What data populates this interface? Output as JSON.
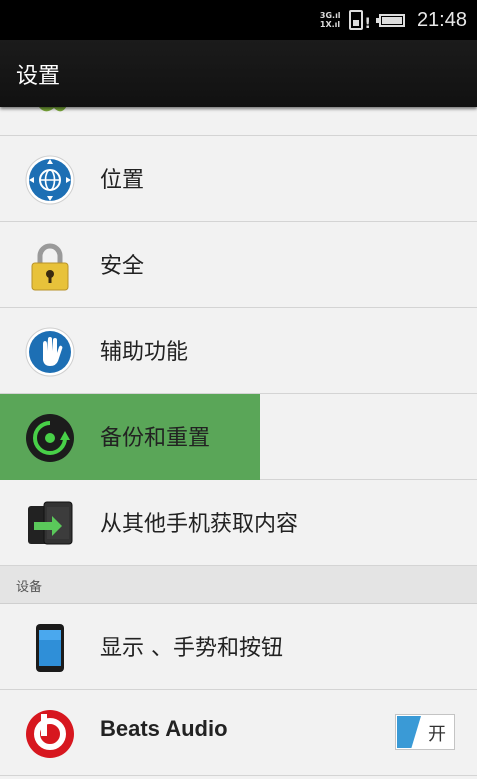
{
  "status_bar": {
    "network_top": "3G.ıl",
    "network_bottom": "1X.ıl",
    "alert": "!",
    "time": "21:48"
  },
  "action_bar": {
    "title": "设置"
  },
  "rows": [
    {
      "label": "位置",
      "icon": "location-globe-icon"
    },
    {
      "label": "安全",
      "icon": "padlock-icon"
    },
    {
      "label": "辅助功能",
      "icon": "hand-icon"
    },
    {
      "label": "备份和重置",
      "icon": "backup-restore-icon",
      "highlighted": true
    },
    {
      "label": "从其他手机获取内容",
      "icon": "phone-transfer-icon"
    }
  ],
  "section": {
    "label": "设备"
  },
  "device_rows": [
    {
      "label": "显示 、手势和按钮",
      "icon": "phone-display-icon"
    },
    {
      "label": "Beats Audio",
      "icon": "beats-logo-icon",
      "toggle_label": "开",
      "toggle_on": true
    }
  ],
  "colors": {
    "highlight": "#5aa658",
    "toggle_accent": "#3a9ad6",
    "beats_red": "#d7171f"
  }
}
